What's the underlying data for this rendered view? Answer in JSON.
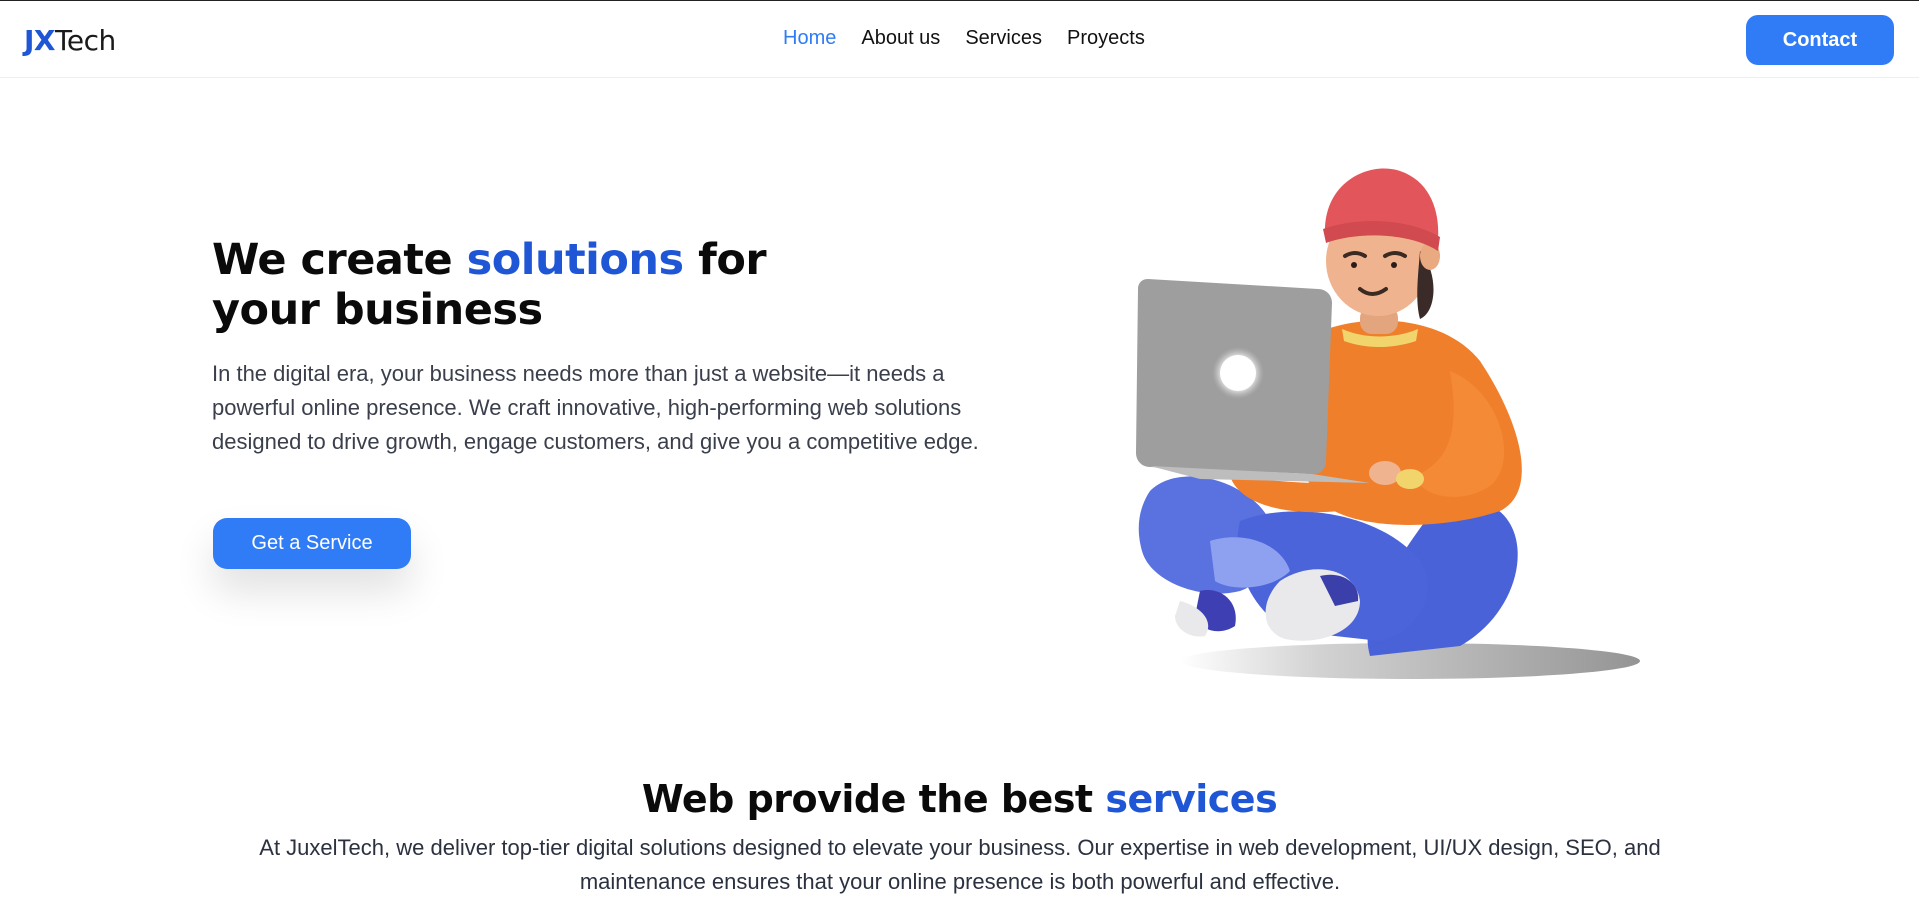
{
  "header": {
    "logo": {
      "part1": "JX",
      "part2": "Tech"
    },
    "nav": [
      {
        "label": "Home",
        "active": true
      },
      {
        "label": "About us",
        "active": false
      },
      {
        "label": "Services",
        "active": false
      },
      {
        "label": "Proyects",
        "active": false
      }
    ],
    "contact_label": "Contact"
  },
  "hero": {
    "title_part1": "We create ",
    "title_accent": "solutions",
    "title_part2": " for your business",
    "description": "In the digital era, your business needs more than just a website—it needs a powerful online presence. We craft innovative, high-performing web solutions designed to drive growth, engage customers, and give you a competitive edge.",
    "cta_label": "Get a Service",
    "illustration_icon": "person-with-laptop-illustration"
  },
  "services": {
    "title_part1": "Web provide the best ",
    "title_accent": "services",
    "description": "At JuxelTech, we deliver top-tier digital solutions designed to elevate your business. Our expertise in web development, UI/UX design, SEO, and maintenance ensures that your online presence is both powerful and effective."
  },
  "colors": {
    "primary": "#2f7cf6",
    "accent": "#1e56d6",
    "nav_active": "#2f7cf6",
    "text": "#111111",
    "body_text": "#3a3f4b"
  }
}
